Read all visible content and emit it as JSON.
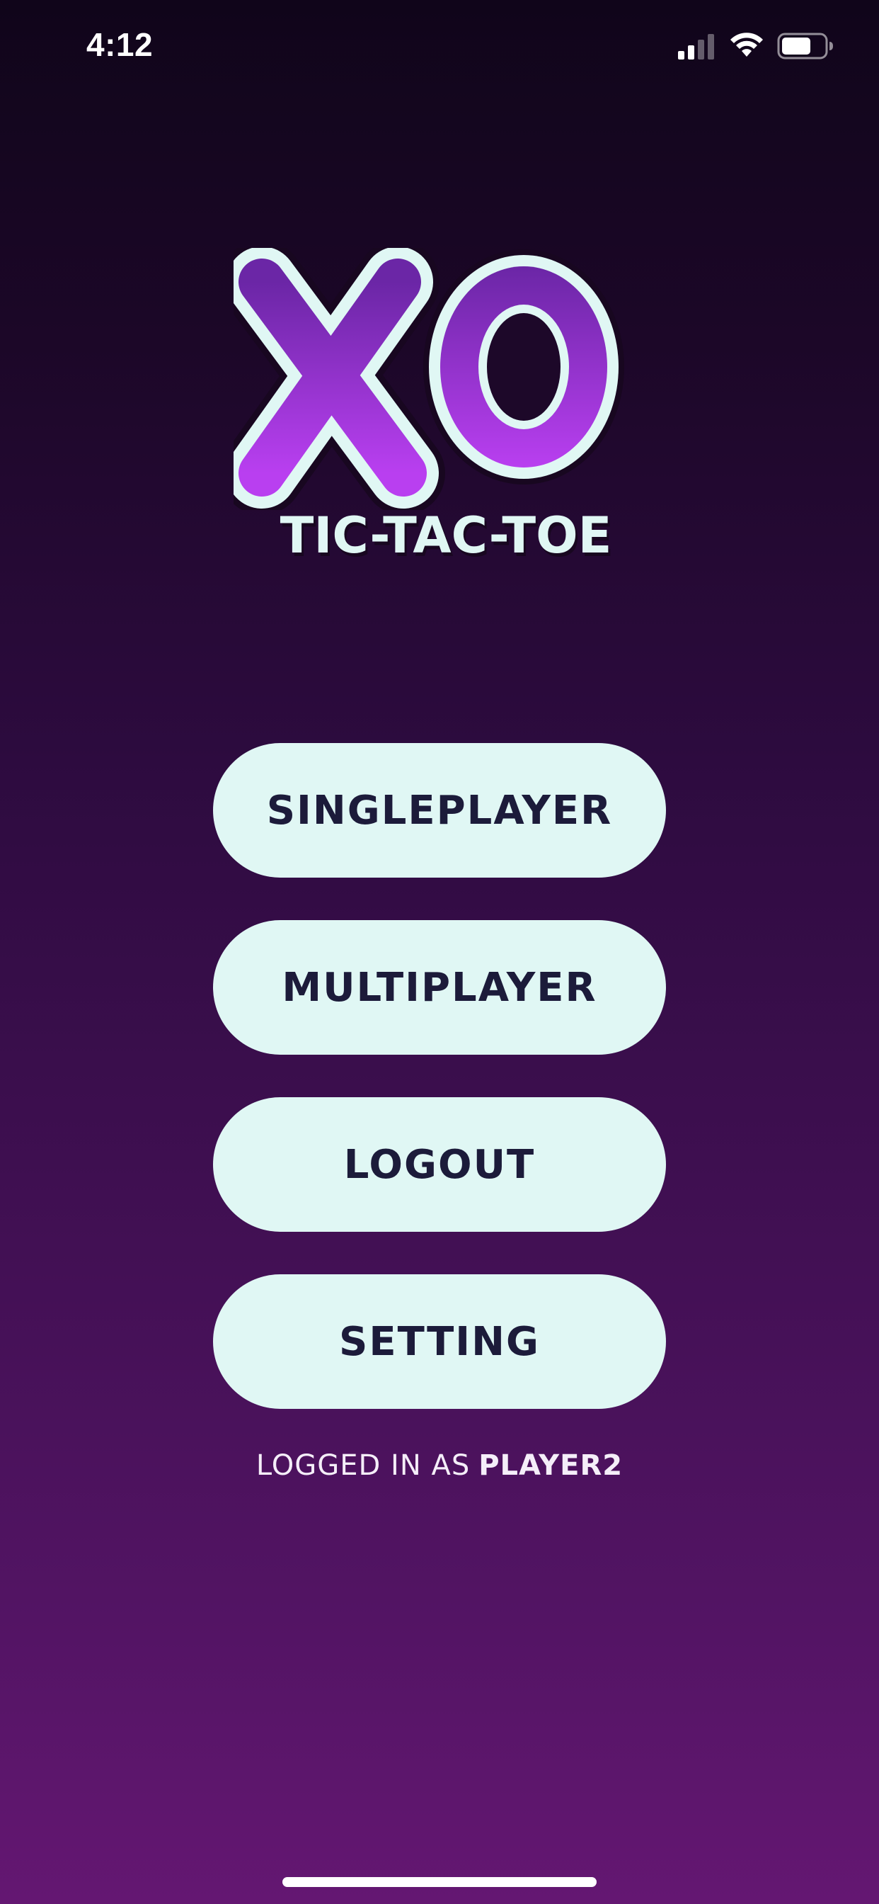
{
  "status_bar": {
    "time": "4:12",
    "icons": [
      "cellular-signal-icon",
      "wifi-icon",
      "battery-icon"
    ]
  },
  "logo": {
    "mark": "XO",
    "subtitle": "TIC-TAC-TOE",
    "colors": {
      "fill_top": "#6b26a6",
      "fill_bottom": "#b93ff0",
      "outline": "#e0f7f4",
      "stroke": "#180720"
    }
  },
  "menu": {
    "buttons": [
      {
        "label": "SINGLEPLAYER"
      },
      {
        "label": "MULTIPLAYER"
      },
      {
        "label": "LOGOUT"
      },
      {
        "label": "SETTING"
      }
    ]
  },
  "login_status": {
    "prefix": "LOGGED IN AS",
    "username": "PLAYER2"
  },
  "colors": {
    "background_top": "#10051a",
    "background_bottom": "#641772",
    "button_bg": "#e0f7f4",
    "button_text": "#1c1b3a"
  }
}
